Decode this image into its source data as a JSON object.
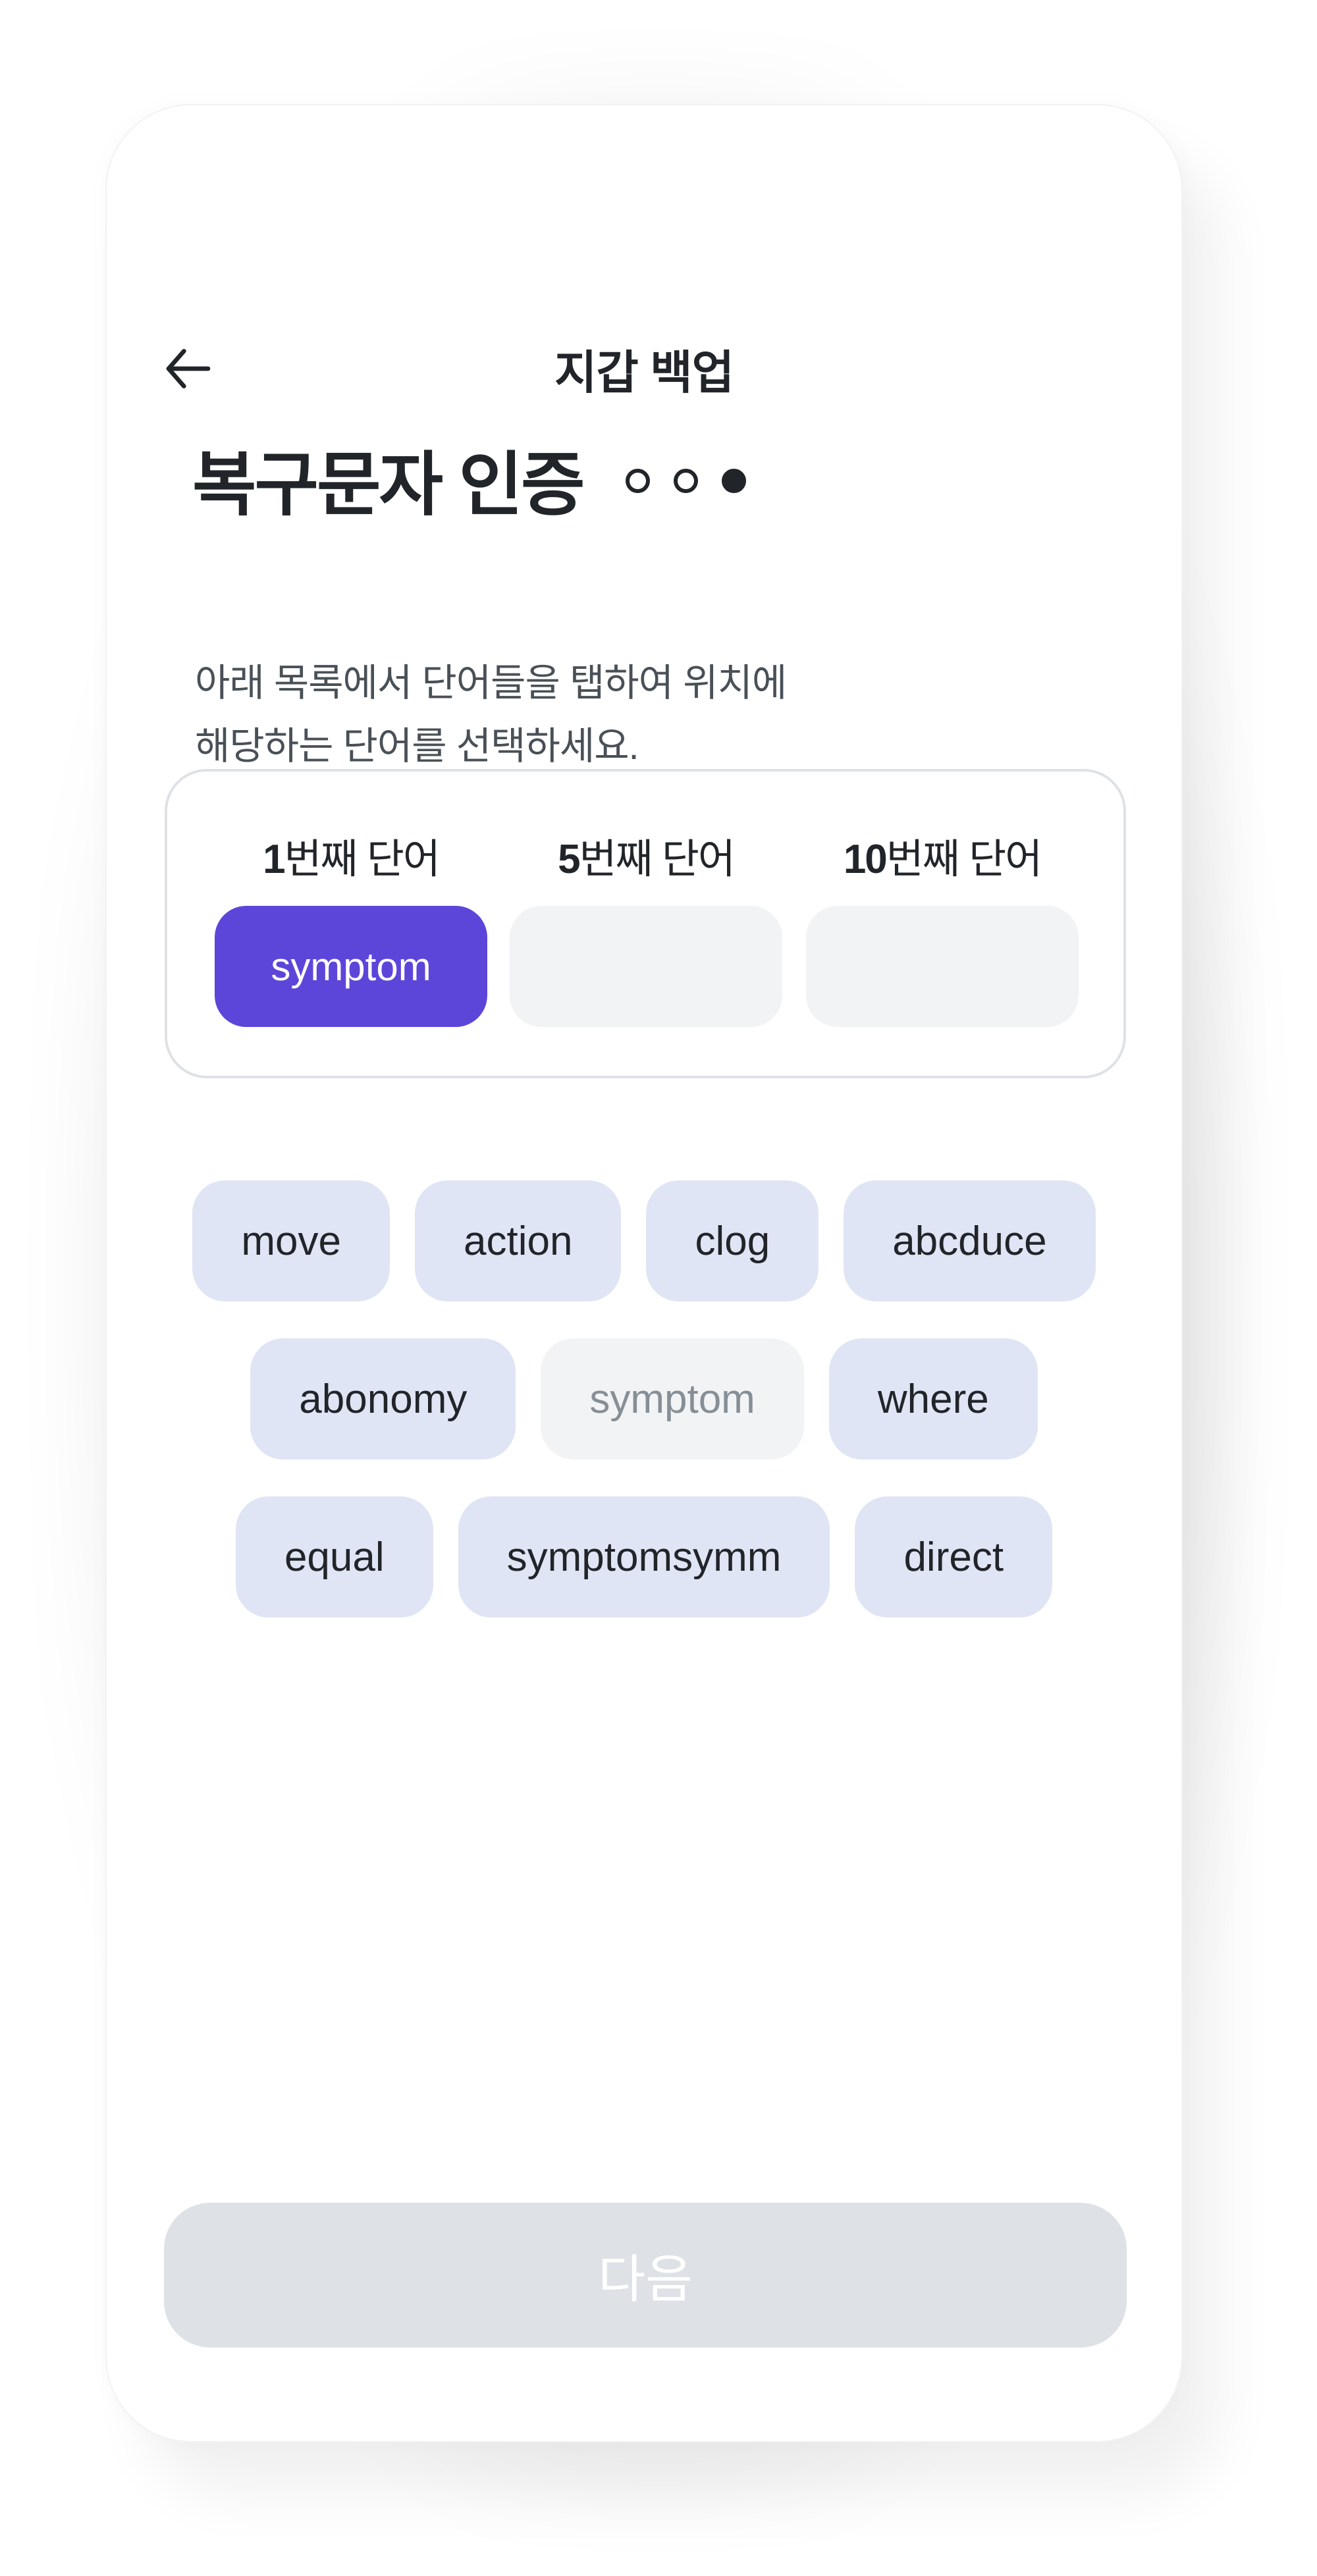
{
  "header": {
    "title": "지갑 백업",
    "back_icon": "arrow-left-icon"
  },
  "main": {
    "title": "복구문자 인증",
    "steps": {
      "total": 3,
      "current": 3
    },
    "description_line1": "아래 목록에서 단어들을 탭하여 위치에",
    "description_line2": "해당하는 단어를 선택하세요."
  },
  "slots": [
    {
      "number": "1",
      "suffix": "번째 단어",
      "value": "symptom",
      "filled": true
    },
    {
      "number": "5",
      "suffix": "번째 단어",
      "value": "",
      "filled": false
    },
    {
      "number": "10",
      "suffix": "번째 단어",
      "value": "",
      "filled": false
    }
  ],
  "word_rows": [
    [
      {
        "word": "move",
        "used": false
      },
      {
        "word": "action",
        "used": false
      },
      {
        "word": "clog",
        "used": false
      },
      {
        "word": "abcduce",
        "used": false
      }
    ],
    [
      {
        "word": "abonomy",
        "used": false
      },
      {
        "word": "symptom",
        "used": true
      },
      {
        "word": "where",
        "used": false
      }
    ],
    [
      {
        "word": "equal",
        "used": false
      },
      {
        "word": "symptomsymm",
        "used": false
      },
      {
        "word": "direct",
        "used": false
      }
    ]
  ],
  "footer": {
    "next_label": "다음",
    "next_enabled": false
  },
  "colors": {
    "accent": "#5c46da",
    "chip_bg": "#e0e5f5",
    "chip_used_bg": "#f1f3f5",
    "slot_empty_bg": "#f1f3f5",
    "button_disabled_bg": "#dee2e6",
    "text_primary": "#212529",
    "text_secondary": "#495057"
  }
}
